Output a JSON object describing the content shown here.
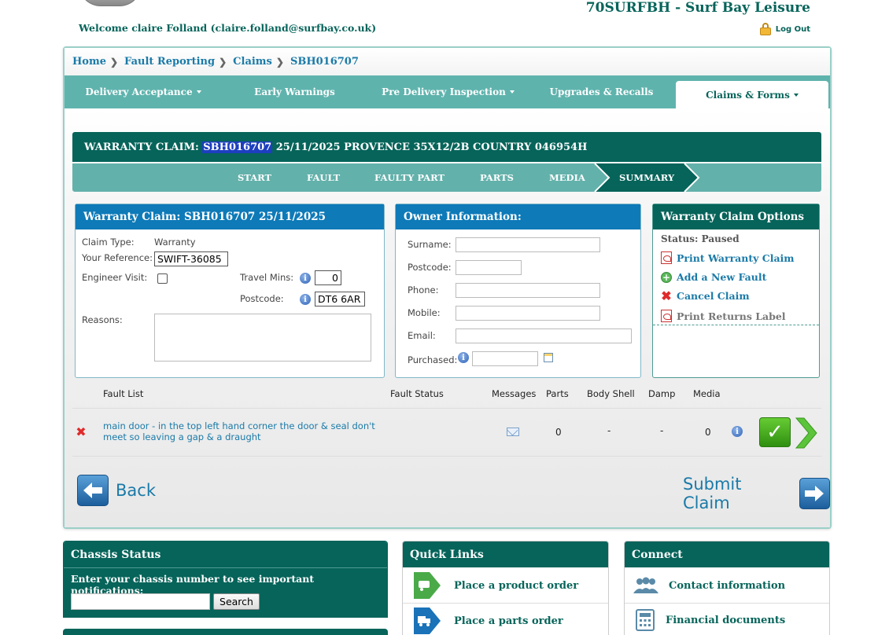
{
  "header": {
    "welcome": "Welcome claire Folland (claire.folland@surfbay.co.uk)",
    "dealer": "70SURFBH - Surf Bay Leisure",
    "logout": "Log Out"
  },
  "breadcrumb": [
    "Home",
    "Fault Reporting",
    "Claims",
    "SBH016707"
  ],
  "nav": [
    {
      "label": "Delivery Acceptance",
      "dropdown": true
    },
    {
      "label": "Early Warnings",
      "dropdown": false
    },
    {
      "label": "Pre Delivery Inspection",
      "dropdown": true
    },
    {
      "label": "Upgrades & Recalls",
      "dropdown": false
    },
    {
      "label": "Claims & Forms",
      "dropdown": true,
      "active": true
    }
  ],
  "claim_title": {
    "prefix": "WARRANTY CLAIM: ",
    "id": "SBH016707",
    "rest": " 25/11/2025 PROVENCE 35X12/2B COUNTRY 046954H"
  },
  "steps": [
    "START",
    "FAULT",
    "FAULTY PART",
    "PARTS",
    "MEDIA",
    "SUMMARY"
  ],
  "warranty_panel": {
    "title": "Warranty Claim: SBH016707 25/11/2025",
    "claim_type_label": "Claim Type:",
    "claim_type": "Warranty",
    "your_ref_label": "Your Reference:",
    "your_ref": "SWIFT-36085",
    "engineer_visit_label": "Engineer Visit:",
    "travel_mins_label": "Travel Mins:",
    "travel_mins": "0",
    "postcode_label": "Postcode:",
    "postcode": "DT6 6AR",
    "reasons_label": "Reasons:",
    "info_glyph": "i"
  },
  "owner_panel": {
    "title": "Owner Information:",
    "fields": [
      "Surname:",
      "Postcode:",
      "Phone:",
      "Mobile:",
      "Email:"
    ],
    "purchased_label": "Purchased:"
  },
  "options_panel": {
    "title": "Warranty Claim Options",
    "status": "Status: Paused",
    "options": [
      "Print Warranty Claim",
      "Add a New Fault",
      "Cancel Claim",
      "Print Returns Label"
    ]
  },
  "fault_table": {
    "headers": [
      "Fault List",
      "Fault Status",
      "Messages",
      "Parts",
      "Body Shell",
      "Damp",
      "Media"
    ],
    "rows": [
      {
        "description": "main door - in the top left hand corner the door & seal don't meet so leaving a gap & a draught",
        "status": "",
        "parts": "0",
        "body_shell": "-",
        "damp": "-",
        "media": "0"
      }
    ]
  },
  "actions": {
    "back": "Back",
    "submit": "Submit Claim",
    "ok_glyph": "✓"
  },
  "widgets": {
    "chassis": {
      "title": "Chassis Status",
      "prompt": "Enter your chassis number to see important notifications:",
      "search": "Search"
    },
    "quick_links": {
      "title": "Quick Links",
      "items": [
        "Place a product order",
        "Place a parts order"
      ]
    },
    "connect": {
      "title": "Connect",
      "items": [
        "Contact information",
        "Financial documents"
      ]
    }
  },
  "colors": {
    "brand_dark": "#06645a",
    "brand_light": "#5fb3ad",
    "link": "#1a7aa8",
    "owner_head": "#0e7ab8"
  }
}
